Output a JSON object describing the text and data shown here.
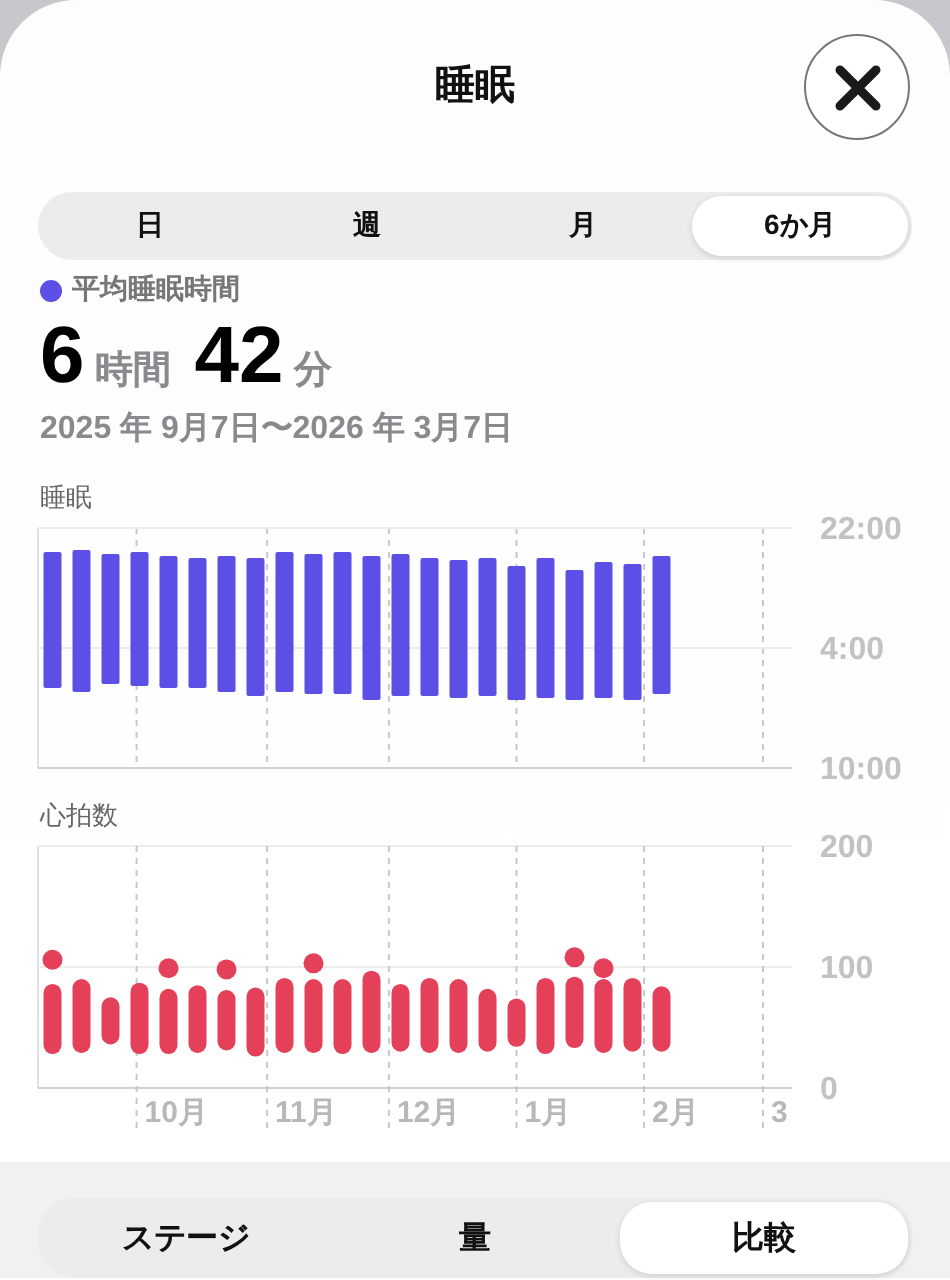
{
  "header": {
    "title": "睡眠"
  },
  "ranges": [
    {
      "label": "日",
      "selected": false
    },
    {
      "label": "週",
      "selected": false
    },
    {
      "label": "月",
      "selected": false
    },
    {
      "label": "6か月",
      "selected": true
    }
  ],
  "summary": {
    "legend": "平均睡眠時間",
    "value": [
      {
        "kind": "number",
        "text": "6"
      },
      {
        "kind": "unit",
        "text": "時間"
      },
      {
        "kind": "number",
        "text": "42"
      },
      {
        "kind": "unit",
        "text": "分"
      }
    ],
    "date_range": "2025 年 9月7日〜2026 年 3月7日"
  },
  "sleep_chart": {
    "title": "睡眠",
    "axis_labels": [
      "22:00",
      "4:00",
      "10:00"
    ]
  },
  "heart_chart": {
    "title": "心拍数",
    "axis_labels": [
      "200",
      "100",
      "0"
    ],
    "month_labels": [
      "10月",
      "11月",
      "12月",
      "1月",
      "2月",
      "3"
    ]
  },
  "views": [
    {
      "label": "ステージ",
      "selected": false
    },
    {
      "label": "量",
      "selected": false
    },
    {
      "label": "比較",
      "selected": true
    }
  ]
}
